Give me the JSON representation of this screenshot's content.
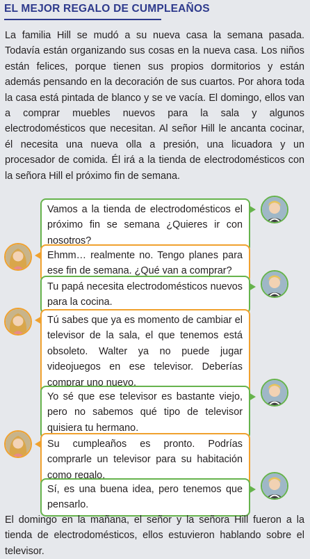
{
  "title": "El mejor regalo de cumpleaños",
  "intro": "La familia Hill se mudó a su nueva casa la semana pasada. Todavía están organizando sus cosas en la nueva casa. Los niños están felices, porque tienen sus propios dormitorios y están además pensando en la decoración de sus cuartos. Por ahora toda la casa está pintada de blanco y se ve vacía. El domingo, ellos van a comprar muebles nuevos para la sala y algunos electrodomésticos que necesitan. Al señor Hill le ancanta cocinar, él necesita una nueva olla a presión, una licuadora y un procesador de comida. Él irá a la tienda de electrodomésticos con la señora Hill el próximo fin de semana.",
  "dialogue": [
    {
      "speaker_icon": "boy-avatar-icon",
      "text": "Vamos a la tienda de electrodomésticos el próximo fin se semana ¿Quieres ir con nosotros?"
    },
    {
      "speaker_icon": "girl-avatar-icon",
      "text": "Ehmm… realmente no. Tengo planes para ese fin de semana. ¿Qué van a comprar?"
    },
    {
      "speaker_icon": "boy-avatar-icon",
      "text": "Tu papá necesita electrodomésticos nuevos para la cocina."
    },
    {
      "speaker_icon": "girl-avatar-icon",
      "text": "Tú sabes que ya es momento de cambiar el televisor de la sala, el que tenemos está obsoleto. Walter ya no puede jugar videojuegos en ese televisor. Deberías comprar uno nuevo."
    },
    {
      "speaker_icon": "boy-avatar-icon",
      "text": "Yo sé que ese televisor es bastante viejo, pero no sabemos qué tipo de televisor quisiera tu hermano."
    },
    {
      "speaker_icon": "girl-avatar-icon",
      "text": "Su cumpleaños es pronto. Podrías comprarle un televisor para su habitación como regalo."
    },
    {
      "speaker_icon": "boy-avatar-icon",
      "text": "Sí, es una buena idea, pero tenemos que pensarlo."
    }
  ],
  "outro": "El domingo en la mañana, el señor y la señora Hill fueron a la tienda de electrodomésticos, ellos estuvieron hablando sobre el televisor.",
  "colors": {
    "title": "#2e3a8c",
    "green_border": "#66b34c",
    "orange_border": "#f0a12e",
    "background": "#e6e8ec"
  }
}
